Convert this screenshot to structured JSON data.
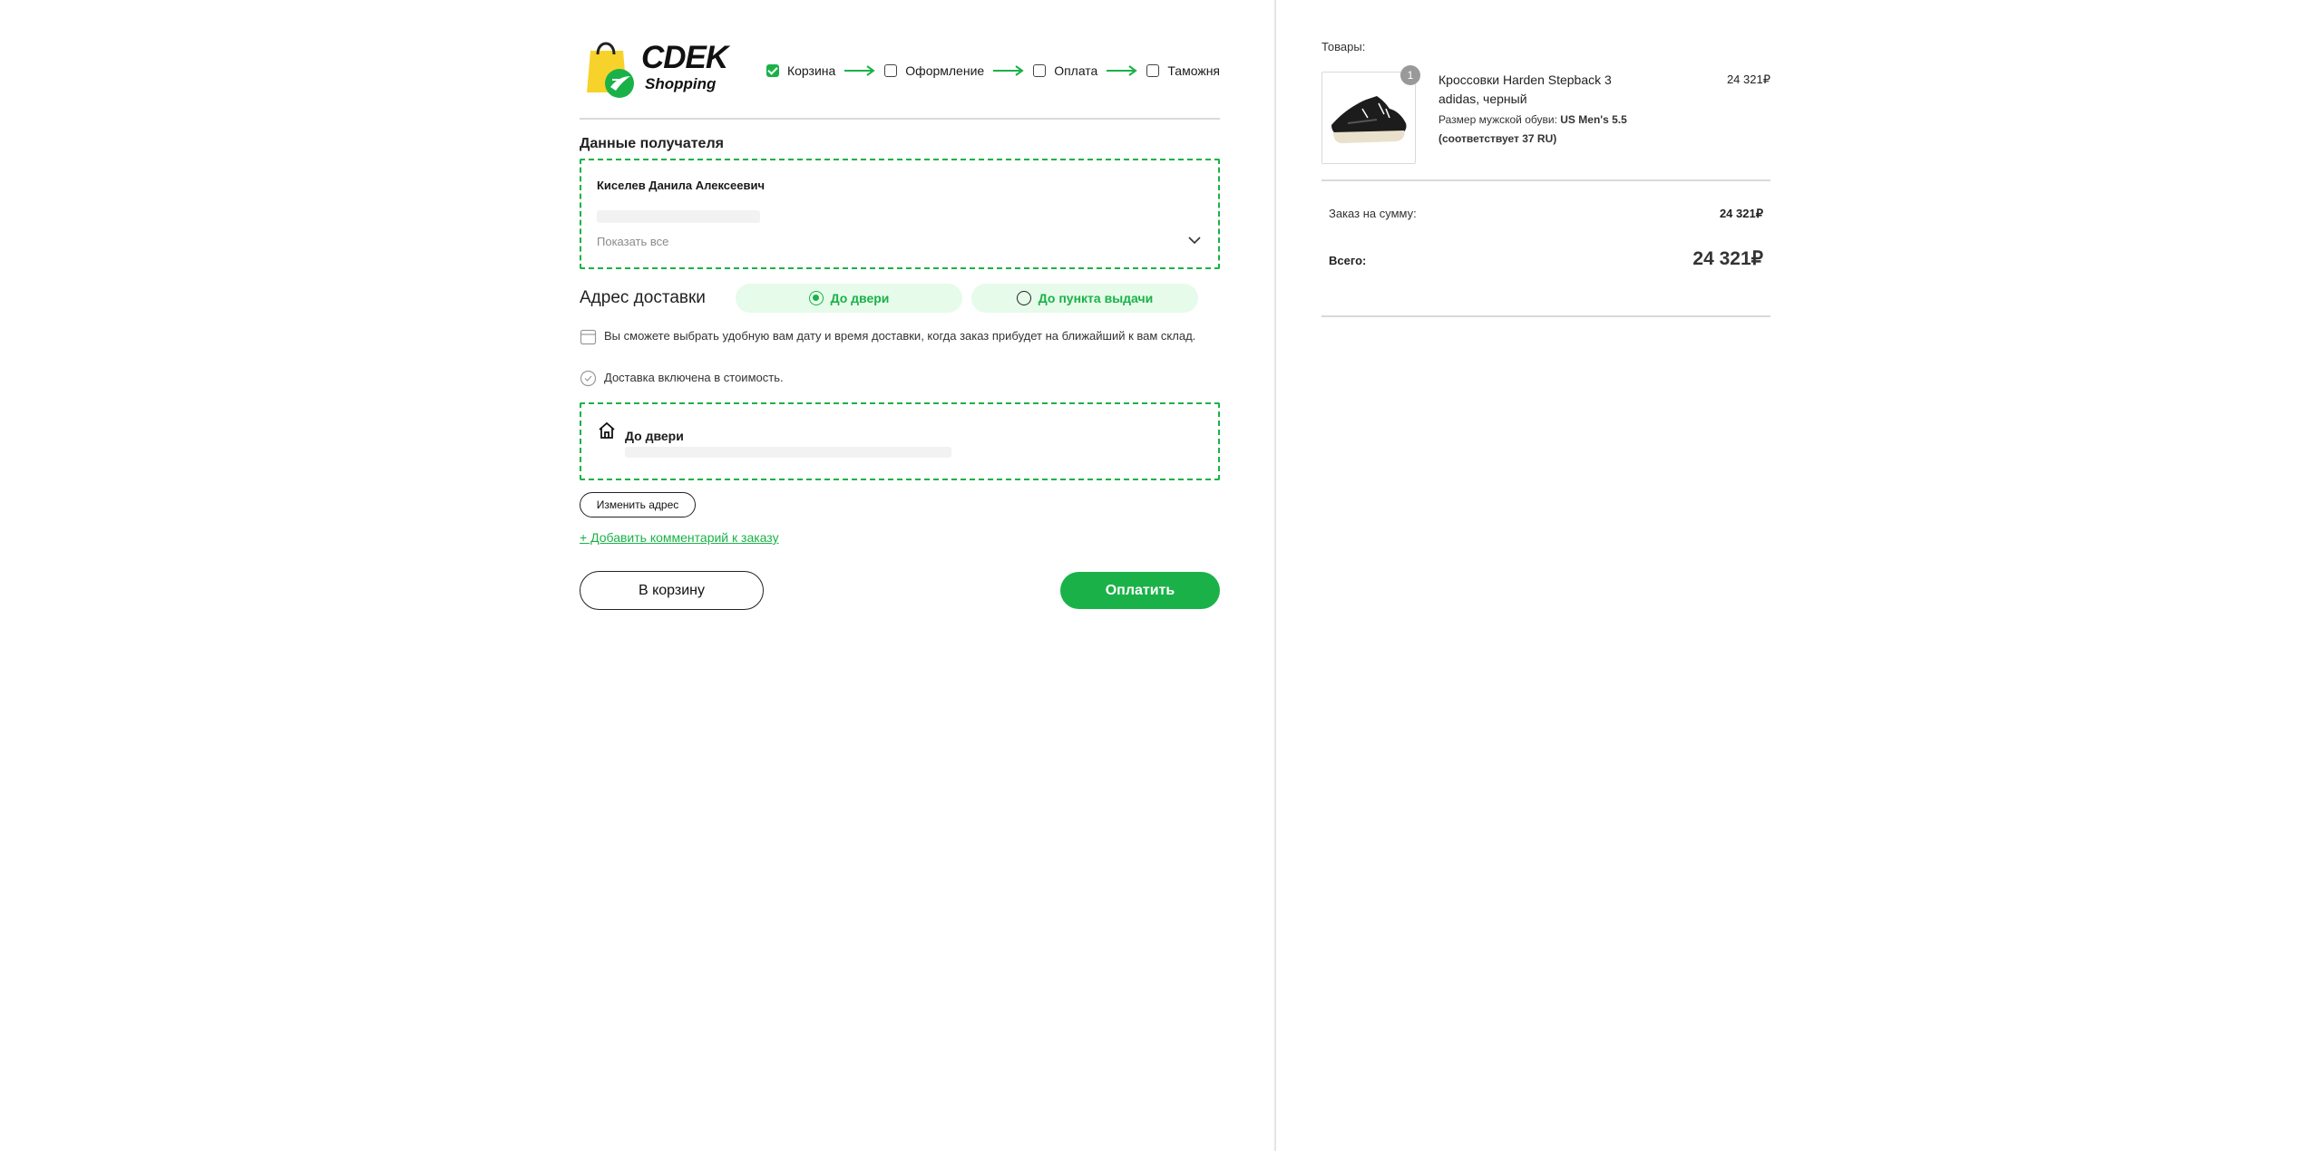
{
  "brand": {
    "line1": "CDEK",
    "line2": "Shopping"
  },
  "steps": [
    {
      "label": "Корзина",
      "checked": true
    },
    {
      "label": "Оформление",
      "checked": false
    },
    {
      "label": "Оплата",
      "checked": false
    },
    {
      "label": "Таможня",
      "checked": false
    }
  ],
  "recipient": {
    "title": "Данные получателя",
    "name": "Киселев Данила Алексеевич",
    "show_all": "Показать все"
  },
  "delivery": {
    "title": "Адрес доставки",
    "option_door": "До двери",
    "option_pickup": "До пункта выдачи",
    "selected": "door",
    "info_schedule": "Вы сможете выбрать удобную вам дату и время доставки, когда заказ прибудет на ближайший к вам склад.",
    "info_included": "Доставка включена в стоимость.",
    "address_type": "До двери",
    "change_button": "Изменить адрес",
    "add_comment": "+ Добавить комментарий к заказу"
  },
  "actions": {
    "back": "В корзину",
    "pay": "Оплатить"
  },
  "cart": {
    "goods_label": "Товары:",
    "item": {
      "quantity": "1",
      "name": "Кроссовки Harden Stepback 3 adidas, черный",
      "size_label": "Размер мужской обуви:",
      "size_value": "US Men's 5.5 (соответствует 37 RU)",
      "price": "24 321₽"
    },
    "sum_label": "Заказ на сумму:",
    "sum_value": "24 321₽",
    "total_label": "Всего:",
    "total_value": "24 321₽"
  },
  "colors": {
    "accent": "#1ab248",
    "accent_light": "#e6fbea",
    "logo_bag": "#f7d22b"
  }
}
